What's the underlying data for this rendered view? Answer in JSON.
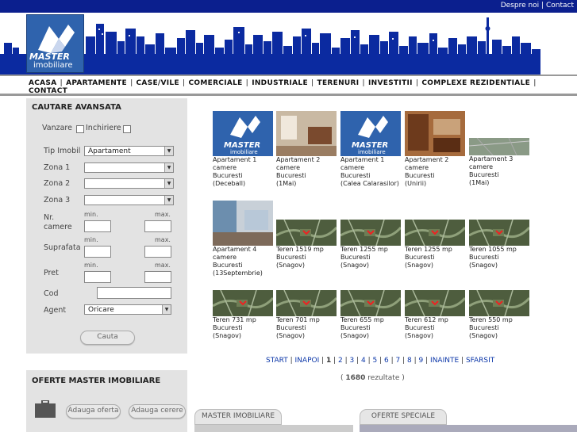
{
  "top_links": {
    "despre": "Despre noi",
    "sep": "|",
    "contact": "Contact"
  },
  "logo": {
    "line1": "MASTER",
    "line2": "imobiliare"
  },
  "nav": [
    "ACASA",
    "APARTAMENTE",
    "CASE/VILE",
    "COMERCIALE",
    "INDUSTRIALE",
    "TERENURI",
    "INVESTITII",
    "COMPLEXE REZIDENTIALE",
    "CONTACT"
  ],
  "search": {
    "title": "CAUTARE AVANSATA",
    "vanzare": "Vanzare",
    "inchiriere": "Inchiriere",
    "tip_label": "Tip Imobil",
    "tip_value": "Apartament",
    "zona1": "Zona 1",
    "zona2": "Zona 2",
    "zona3": "Zona 3",
    "min": "min.",
    "max": "max.",
    "camere_label1": "Nr.",
    "camere_label2": "camere",
    "suprafata": "Suprafata",
    "pret": "Pret",
    "cod": "Cod",
    "agent": "Agent",
    "agent_value": "Oricare",
    "button": "Cauta"
  },
  "oferte_panel": {
    "title": "OFERTE MASTER IMOBILIARE",
    "add_offer": "Adauga oferta",
    "add_request": "Adauga cerere"
  },
  "listings": [
    {
      "l1": "Apartament 1",
      "l2": "camere",
      "l3": "Bucuresti",
      "l4": "(Deceball)",
      "kind": "logo"
    },
    {
      "l1": "Apartament 2",
      "l2": "camere",
      "l3": "Bucuresti",
      "l4": "(1Mai)",
      "kind": "room"
    },
    {
      "l1": "Apartament 1",
      "l2": "camere",
      "l3": "Bucuresti",
      "l4": "(Calea Calarasilor)",
      "kind": "logo"
    },
    {
      "l1": "Apartament 2",
      "l2": "camere",
      "l3": "Bucuresti",
      "l4": "(Unirii)",
      "kind": "room2"
    },
    {
      "l1": "Apartament 3",
      "l2": "camere",
      "l3": "Bucuresti",
      "l4": "(1Mai)",
      "kind": "aerial"
    },
    {
      "l1": "Apartament 4",
      "l2": "camere",
      "l3": "Bucuresti",
      "l4": "(13Septembrie)",
      "kind": "kitchen"
    },
    {
      "l1": "Teren 1519 mp",
      "l2": "Bucuresti",
      "l3": "(Snagov)",
      "l4": "",
      "kind": "map"
    },
    {
      "l1": "Teren 1255 mp",
      "l2": "Bucuresti",
      "l3": "(Snagov)",
      "l4": "",
      "kind": "map"
    },
    {
      "l1": "Teren 1255 mp",
      "l2": "Bucuresti",
      "l3": "(Snagov)",
      "l4": "",
      "kind": "map"
    },
    {
      "l1": "Teren 1055 mp",
      "l2": "Bucuresti",
      "l3": "(Snagov)",
      "l4": "",
      "kind": "map"
    },
    {
      "l1": "Teren 731 mp",
      "l2": "Bucuresti",
      "l3": "(Snagov)",
      "l4": "",
      "kind": "map"
    },
    {
      "l1": "Teren 701 mp",
      "l2": "Bucuresti",
      "l3": "(Snagov)",
      "l4": "",
      "kind": "map"
    },
    {
      "l1": "Teren 655 mp",
      "l2": "Bucuresti",
      "l3": "(Snagov)",
      "l4": "",
      "kind": "map"
    },
    {
      "l1": "Teren 612 mp",
      "l2": "Bucuresti",
      "l3": "(Snagov)",
      "l4": "",
      "kind": "map"
    },
    {
      "l1": "Teren 550 mp",
      "l2": "Bucuresti",
      "l3": "(Snagov)",
      "l4": "",
      "kind": "map"
    }
  ],
  "pager": [
    "START",
    "INAPOI",
    "1",
    "2",
    "3",
    "4",
    "5",
    "6",
    "7",
    "8",
    "9",
    "INAINTE",
    "SFARSIT"
  ],
  "results": {
    "open": "( ",
    "count": "1680",
    "text": " rezultate )"
  },
  "tabs": {
    "master": "MASTER IMOBILIARE",
    "oferte": "OFERTE SPECIALE"
  },
  "colors": {
    "brand_blue": "#0b1f8e",
    "link_blue": "#0b36a8"
  }
}
